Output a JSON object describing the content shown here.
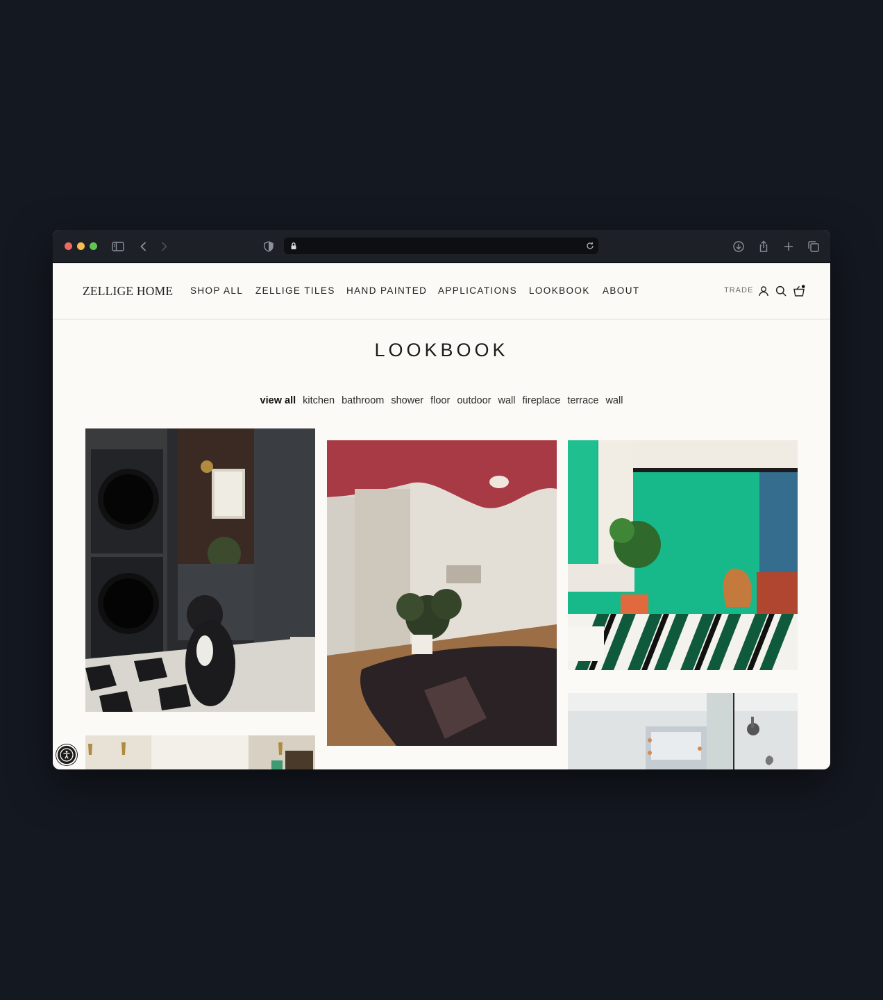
{
  "browser": {
    "traffic_lights": [
      "#ed6a5e",
      "#f5bf4f",
      "#61c554"
    ],
    "icons": [
      "sidebar-icon",
      "back-icon",
      "forward-icon",
      "shield-icon",
      "lock-icon",
      "reload-icon",
      "download-icon",
      "share-icon",
      "new-tab-icon",
      "tabs-icon"
    ]
  },
  "header": {
    "logo": "ZELLIGE HOME",
    "nav": [
      "SHOP ALL",
      "ZELLIGE TILES",
      "HAND PAINTED",
      "APPLICATIONS",
      "LOOKBOOK",
      "ABOUT"
    ],
    "trade": "TRADE",
    "icons": [
      "account-icon",
      "search-icon",
      "cart-icon"
    ]
  },
  "page": {
    "title": "LOOKBOOK",
    "filters": [
      "view all",
      "kitchen",
      "bathroom",
      "shower",
      "floor",
      "outdoor",
      "wall",
      "fireplace",
      "terrace",
      "wall"
    ],
    "active_filter": "view all"
  },
  "gallery": [
    {
      "name": "laundry-room-photo",
      "accent": "#2b2d30"
    },
    {
      "name": "curved-shower-photo",
      "accent": "#a83a45"
    },
    {
      "name": "green-tile-bathroom-photo",
      "accent": "#17b98b"
    },
    {
      "name": "brass-hooks-photo",
      "accent": "#e7e1d6"
    },
    {
      "name": "glass-shower-photo",
      "accent": "#dfe3e3"
    }
  ]
}
